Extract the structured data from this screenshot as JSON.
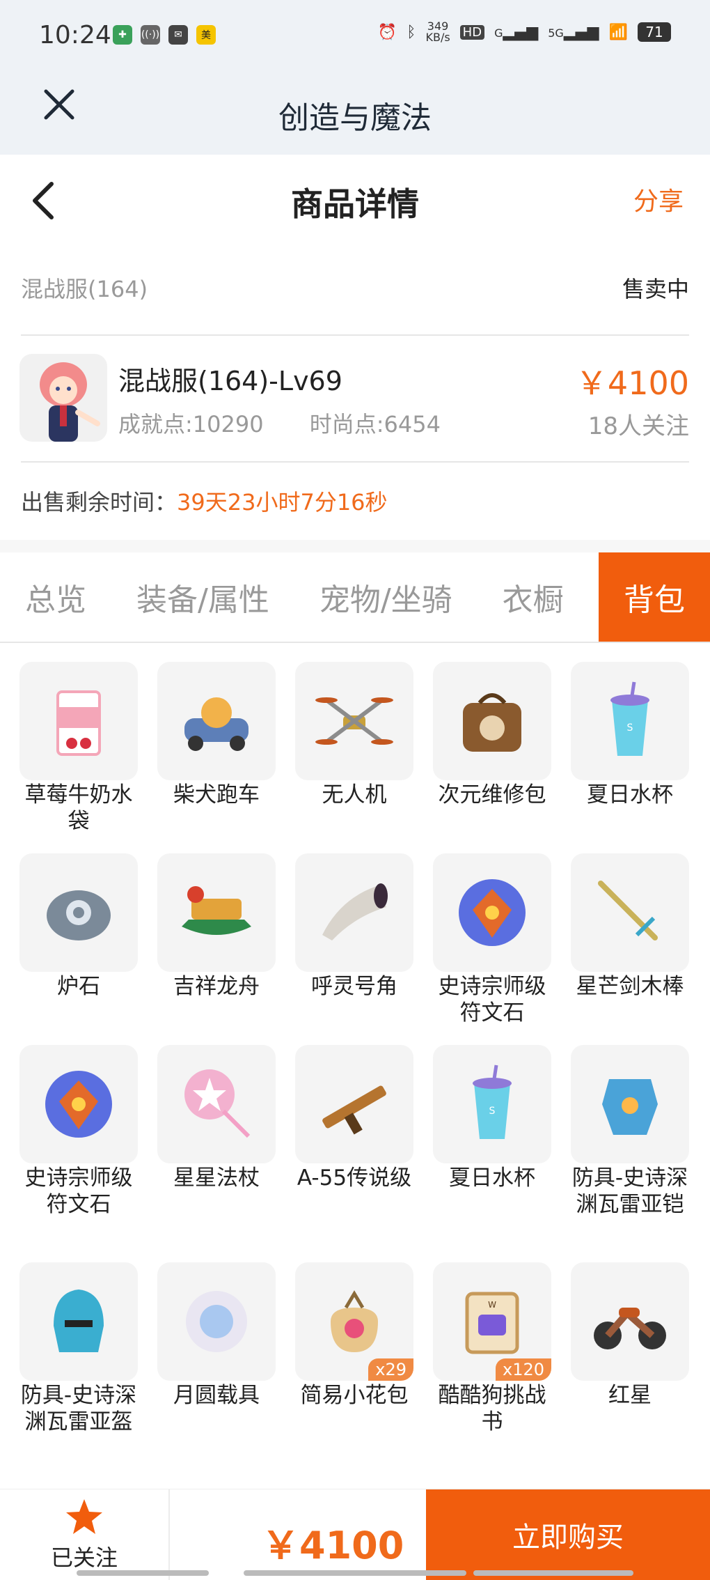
{
  "status_bar": {
    "time": "10:24",
    "net_speed_value": "349",
    "net_speed_unit": "KB/s",
    "battery": "71",
    "hd_label": "HD",
    "signal_label": "G",
    "fiveg_label": "5G",
    "left_icons": [
      "app-icon-1",
      "hotspot-icon",
      "message-icon",
      "meituan-icon"
    ]
  },
  "app": {
    "title": "创造与魔法"
  },
  "nav": {
    "title": "商品详情",
    "share_label": "分享"
  },
  "listing": {
    "server": "混战服(164)",
    "status": "售卖中",
    "name": "混战服(164)-Lv69",
    "achievement": "成就点:10290",
    "fashion": "时尚点:6454",
    "price": "￥4100",
    "followers": "18人关注",
    "remaining_label": "出售剩余时间：",
    "remaining_value": "39天23小时7分16秒"
  },
  "tabs": [
    {
      "label": "总览"
    },
    {
      "label": "装备/属性"
    },
    {
      "label": "宠物/坐骑"
    },
    {
      "label": "衣橱"
    },
    {
      "label": "背包",
      "active": true
    }
  ],
  "items": [
    {
      "label": "草莓牛奶水袋",
      "icon": "milk-bag-icon",
      "color": "#f4a6b8"
    },
    {
      "label": "柴犬跑车",
      "icon": "shiba-car-icon",
      "color": "#f2b24a"
    },
    {
      "label": "无人机",
      "icon": "drone-icon",
      "color": "#8c8c8c"
    },
    {
      "label": "次元维修包",
      "icon": "repair-bag-icon",
      "color": "#8a5a2e"
    },
    {
      "label": "夏日水杯",
      "icon": "summer-cup-icon",
      "color": "#6ad0e8"
    },
    {
      "label": "炉石",
      "icon": "hearthstone-icon",
      "color": "#7b8a99"
    },
    {
      "label": "吉祥龙舟",
      "icon": "dragon-boat-icon",
      "color": "#e3a33a"
    },
    {
      "label": "呼灵号角",
      "icon": "horn-icon",
      "color": "#d9d4cc"
    },
    {
      "label": "史诗宗师级符文石",
      "icon": "rune-stone-icon",
      "color": "#5a6ee0"
    },
    {
      "label": "星芒剑木棒",
      "icon": "star-sword-icon",
      "color": "#c9b25a"
    },
    {
      "label": "史诗宗师级符文石",
      "icon": "rune-stone-icon",
      "color": "#5a6ee0"
    },
    {
      "label": "星星法杖",
      "icon": "star-staff-icon",
      "color": "#f3a0c6"
    },
    {
      "label": "A-55传说级",
      "icon": "rifle-icon",
      "color": "#b5742f"
    },
    {
      "label": "夏日水杯",
      "icon": "summer-cup-icon",
      "color": "#6ad0e8"
    },
    {
      "label": "防具-史诗深渊瓦雷亚铠",
      "icon": "armor-icon",
      "color": "#4aa3d8"
    },
    {
      "label": "防具-史诗深渊瓦雷亚盔",
      "icon": "helmet-icon",
      "color": "#3aaed0"
    },
    {
      "label": "月圆载具",
      "icon": "moon-vehicle-icon",
      "color": "#a9c8f0"
    },
    {
      "label": "简易小花包",
      "icon": "flower-bag-icon",
      "color": "#e8c58a",
      "badge": "x29"
    },
    {
      "label": "酷酷狗挑战书",
      "icon": "challenge-scroll-icon",
      "color": "#c79a5a",
      "badge": "x120"
    },
    {
      "label": "红星",
      "icon": "motorcycle-icon",
      "color": "#9b5a3a"
    }
  ],
  "bottom": {
    "follow_label": "已关注",
    "price": "￥4100",
    "buy_label": "立即购买"
  },
  "colors": {
    "accent": "#f15d0d",
    "price": "#f06a1b"
  }
}
